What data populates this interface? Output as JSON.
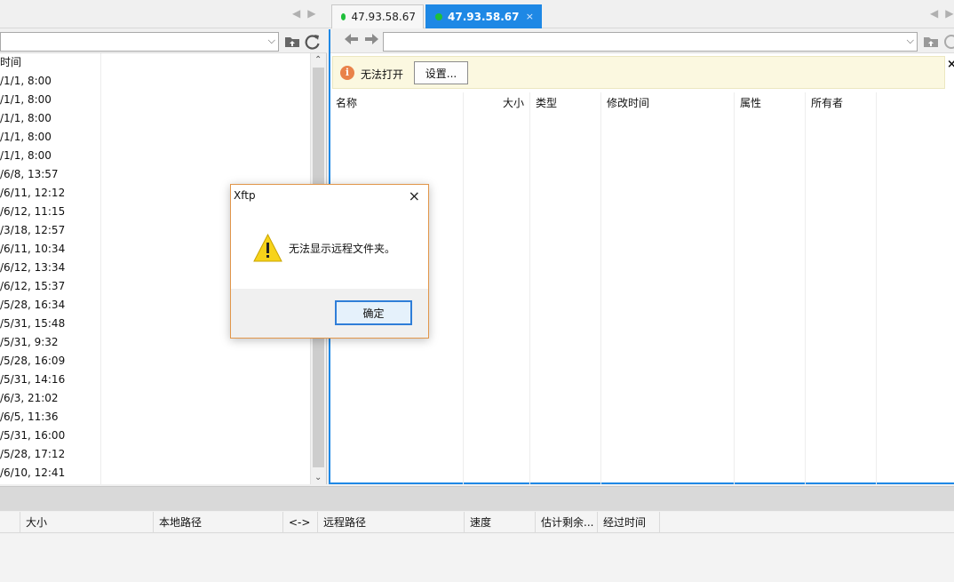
{
  "tabs": [
    {
      "label": "47.93.58.67",
      "active": false
    },
    {
      "label": "47.93.58.67",
      "active": true,
      "close": "×"
    }
  ],
  "left_pane": {
    "column_header": "时间",
    "times": [
      "/1/1, 8:00",
      "/1/1, 8:00",
      "/1/1, 8:00",
      "/1/1, 8:00",
      "/1/1, 8:00",
      "/6/8, 13:57",
      "/6/11, 12:12",
      "/6/12, 11:15",
      "/3/18, 12:57",
      "/6/11, 10:34",
      "/6/12, 13:34",
      "/6/12, 15:37",
      "/5/28, 16:34",
      "/5/31, 15:48",
      "/5/31, 9:32",
      "/5/28, 16:09",
      "/5/31, 14:16",
      "/6/3, 21:02",
      "/6/5, 11:36",
      "/5/31, 16:00",
      "/5/28, 17:12",
      "/6/10, 12:41"
    ]
  },
  "right_pane": {
    "info_message": "无法打开",
    "settings_button": "设置...",
    "info_close": "×",
    "columns": [
      "名称",
      "大小",
      "类型",
      "修改时间",
      "属性",
      "所有者"
    ]
  },
  "transfer": {
    "columns": [
      "大小",
      "本地路径",
      "<->",
      "远程路径",
      "速度",
      "估计剩余...",
      "经过时间"
    ]
  },
  "dialog": {
    "title": "Xftp",
    "message": "无法显示远程文件夹。",
    "ok_button": "确定",
    "close": "×"
  },
  "colors": {
    "accent": "#1e88e5",
    "online_dot": "#1fbf3a",
    "dialog_border": "#e1964a",
    "info_bar": "#fbf8e0"
  },
  "icons": [
    "tab-prev-icon",
    "tab-next-icon",
    "folder-up-icon",
    "refresh-icon",
    "back-arrow-icon",
    "forward-arrow-icon",
    "info-icon",
    "warning-icon",
    "close-icon"
  ]
}
